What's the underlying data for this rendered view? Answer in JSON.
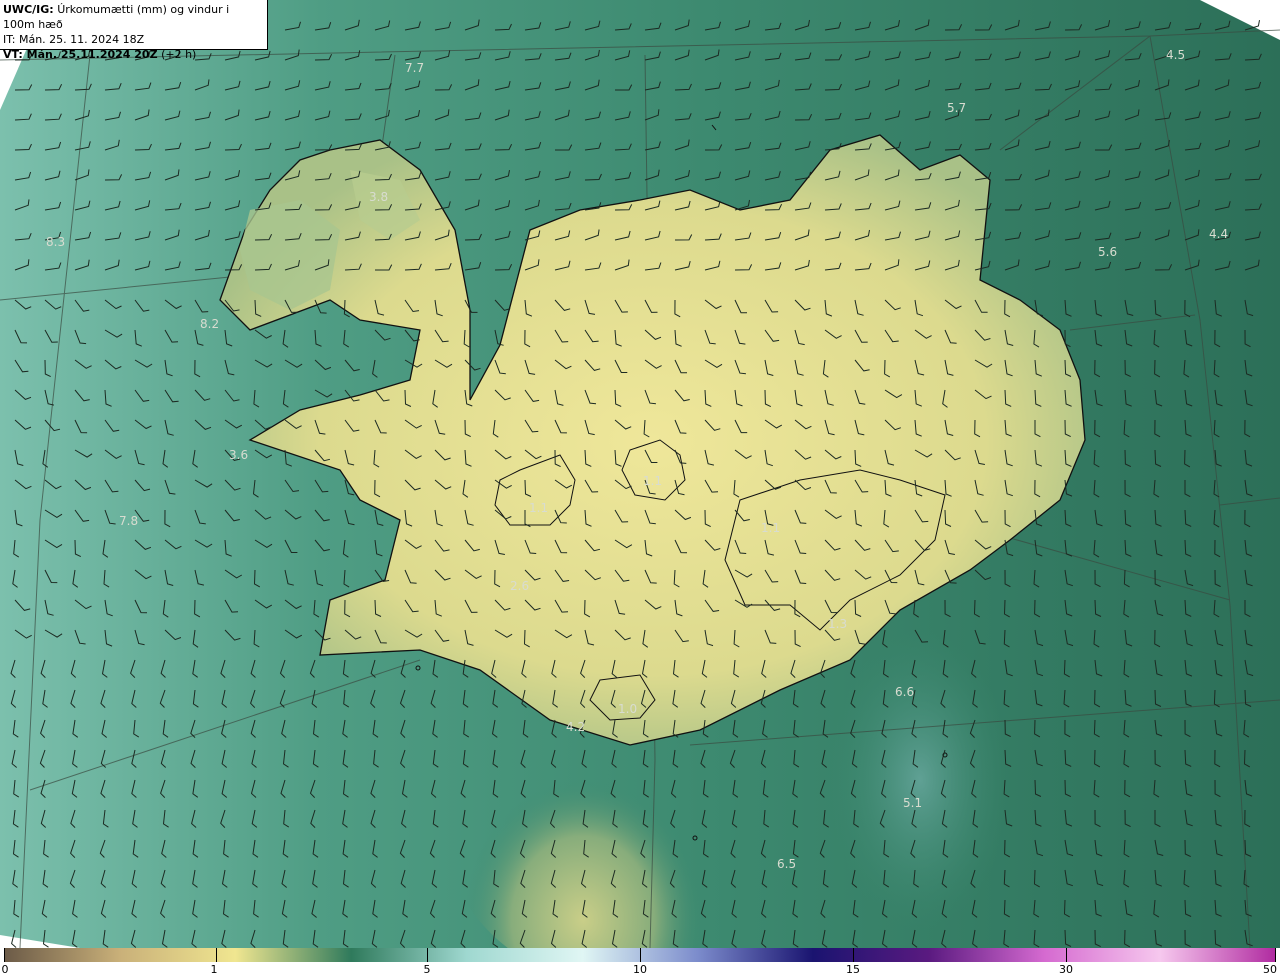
{
  "header": {
    "product": "UWC/IG:",
    "title": "Úrkomumætti (mm) og vindur i 100m hæð",
    "initial_time": "IT: Mán. 25. 11. 2024 18Z",
    "valid_time_bold": "VT: Mán. 25.11.2024 20Z",
    "valid_time_offset": "(+2 h)"
  },
  "colorbar": {
    "tick_labels": [
      "0",
      "1",
      "5",
      "10",
      "15",
      "30",
      "50"
    ],
    "colors": [
      "#6b5a47",
      "#c9b079",
      "#f0e690",
      "#2f7a5c",
      "#9fd8d0",
      "#e0f6f4",
      "#7c8ccc",
      "#1a1470",
      "#5a1a80",
      "#d56ad0",
      "#f6c8ee",
      "#b02aa0"
    ]
  },
  "map_labels": [
    {
      "text": "7.7"
    },
    {
      "text": "5.7"
    },
    {
      "text": "4.5"
    },
    {
      "text": "3.8"
    },
    {
      "text": "8.3"
    },
    {
      "text": "5.6"
    },
    {
      "text": "4.4"
    },
    {
      "text": "8.2"
    },
    {
      "text": "3.6"
    },
    {
      "text": "1.1"
    },
    {
      "text": "1.1"
    },
    {
      "text": "1.1"
    },
    {
      "text": "7.8"
    },
    {
      "text": "2.6"
    },
    {
      "text": "1.3"
    },
    {
      "text": "6.6"
    },
    {
      "text": "1.0"
    },
    {
      "text": "4.2"
    },
    {
      "text": "5.1"
    },
    {
      "text": "6.5"
    }
  ],
  "colors": {
    "ocean_west": "#6fb5a6",
    "ocean_mid": "#3f8e76",
    "ocean_dark": "#2d6e58",
    "land_interior": "#e8e294",
    "land_edge": "#bcc98a",
    "coast": "#111111"
  }
}
